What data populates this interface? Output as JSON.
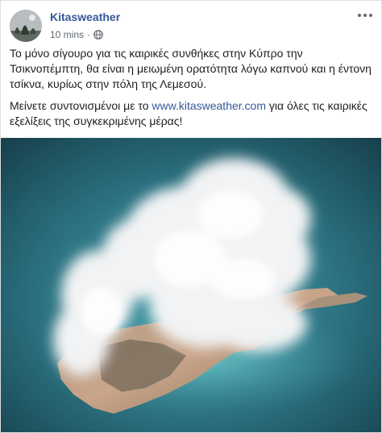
{
  "post": {
    "author": "Kitasweather",
    "time": "10 mins",
    "privacy_icon": "globe-icon",
    "more_icon": "more-options-icon",
    "paragraph1": "Το μόνο σίγουρο για τις καιρικές συνθήκες στην Κύπρο την Τσικνοπέμπτη, θα είναι η μειωμένη ορατότητα λόγω καπνού και η έντονη τσίκνα, κυρίως στην πόλη της Λεμεσού.",
    "paragraph2_before": "Μείνετε συντονισμένοι με το ",
    "paragraph2_link": "www.kitasweather.com",
    "paragraph2_after": " για όλες τις καιρικές εξελίξεις της συγκεκριμένης μέρας!",
    "image_alt": "Satellite view of Cyprus covered by smoke clouds"
  },
  "colors": {
    "link": "#365899",
    "meta": "#616770",
    "text": "#1c1e21",
    "sea": "#3c8c9c"
  }
}
